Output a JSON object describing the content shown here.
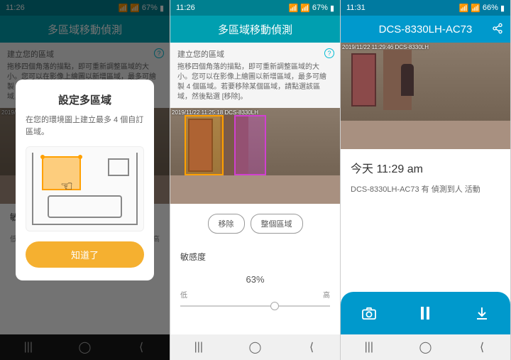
{
  "status": {
    "time1": "11:26",
    "time2": "11:26",
    "time3": "11:31",
    "bat1": "67%",
    "bat2": "67%",
    "bat3": "66%"
  },
  "screen1": {
    "title": "多區域移動偵測",
    "sub_title": "建立您的區域",
    "sub_desc": "拖移四個角落的描點，即可重新調整區域的大小。您可以在影像上繪圖以新增區域，最多可繪製 4 個區域。若要移除某個區域，請點選該區域，然後點選 [移除]。",
    "modal": {
      "title": "設定多區域",
      "desc": "在您的環境圖上建立最多 4 個自訂區域。",
      "cta": "知道了"
    },
    "sens_label": "敏感度",
    "low": "低",
    "high": "高",
    "cam_ts": "2019/11/22  11:25:18  DCS-8330LH"
  },
  "screen2": {
    "title": "多區域移動偵測",
    "sub_title": "建立您的區域",
    "sub_desc": "拖移四個角落的描點，即可重新調整區域的大小。您可以在影像上繪圖以新增區域，最多可繪製 4 個區域。若要移除某個區域，請點選該區域，然後點選 [移除]。",
    "btn_remove": "移除",
    "btn_full": "整個區域",
    "sens_label": "敏感度",
    "sens_val": "63%",
    "low": "低",
    "high": "高",
    "cam_ts": "2019/11/22  11:25:18  DCS-8330LH"
  },
  "screen3": {
    "title": "DCS-8330LH-AC73",
    "cam_ts": "2019/11/22  11:29:46  DCS-8330LH",
    "evt_time": "今天 11:29 am",
    "evt_desc": "DCS-8330LH-AC73 有 偵測到人 活動"
  }
}
